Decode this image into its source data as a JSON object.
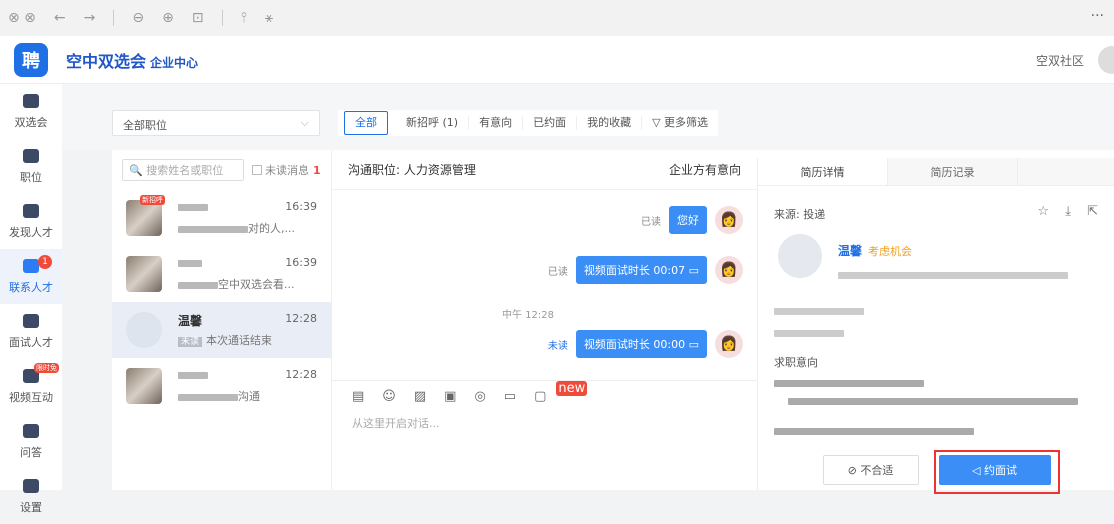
{
  "toolbar": {
    "back": "←",
    "forward": "→",
    "zoom_out": "⊖",
    "zoom_in": "⊕",
    "fit": "⊡",
    "share": "⫯",
    "magic": "⚹",
    "more": "···"
  },
  "header": {
    "logo": "聘",
    "brand": "空中双选会",
    "brand_sub": "企业中心",
    "community": "空双社区"
  },
  "sidebar": {
    "items": [
      {
        "label": "双选会"
      },
      {
        "label": "职位"
      },
      {
        "label": "发现人才"
      },
      {
        "label": "联系人才",
        "badge": "1"
      },
      {
        "label": "面试人才"
      },
      {
        "label": "视频互动",
        "tag": "限时免"
      },
      {
        "label": "问答"
      },
      {
        "label": "设置"
      }
    ]
  },
  "filters": {
    "position_select": "全部职位",
    "chips": [
      "全部",
      "新招呼 (1)",
      "有意向",
      "已约面",
      "我的收藏",
      "▽ 更多筛选"
    ]
  },
  "list": {
    "search_placeholder": "搜索姓名或职位",
    "unread_label": "未读消息",
    "unread_count": "1",
    "items": [
      {
        "time": "16:39",
        "sub_tail": "对的人,...",
        "tag": "新招呼"
      },
      {
        "time": "16:39",
        "sub_tail": "空中双选会看..."
      },
      {
        "name": "温馨",
        "time": "12:28",
        "status": "未读",
        "sub": "本次通话结束"
      },
      {
        "time": "12:28",
        "sub_tail": "沟通"
      }
    ]
  },
  "chat": {
    "position_label": "沟通职位:",
    "position": "人力资源管理",
    "intent": "企业方有意向",
    "messages": [
      {
        "text": "您好",
        "read": "已读"
      },
      {
        "text": "视频面试时长 00:07",
        "read": "已读"
      },
      {
        "text": "视频面试时长 00:00",
        "read": "未读"
      }
    ],
    "timestamp": "中午 12:28",
    "placeholder": "从这里开启对话...",
    "new_tag": "new"
  },
  "resume": {
    "tabs": [
      "简历详情",
      "简历记录"
    ],
    "source": "来源: 投递",
    "name": "温馨",
    "status": "考虑机会",
    "section": "求职意向",
    "btn_reject": "不合适",
    "btn_interview": "约面试"
  }
}
